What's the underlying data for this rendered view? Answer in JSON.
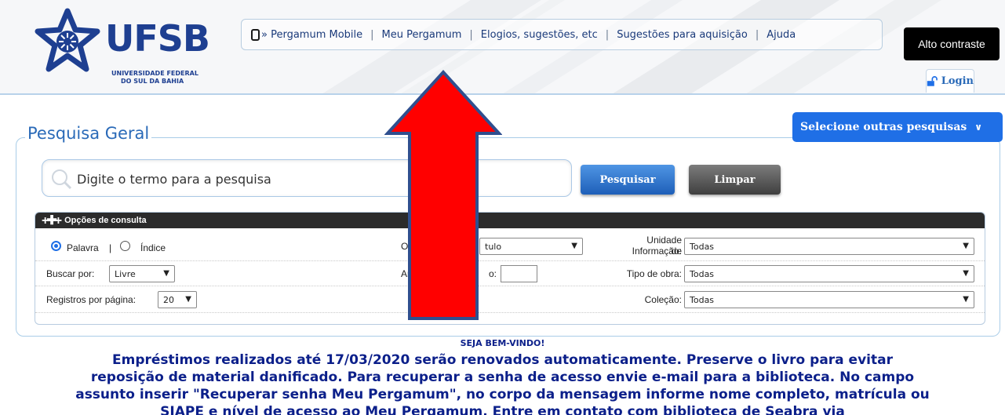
{
  "logo": {
    "name": "UFSB",
    "sub1": "UNIVERSIDADE FEDERAL",
    "sub2": "DO SUL DA BAHIA",
    "icon": "ufsb-star-logo"
  },
  "topnav": {
    "items": [
      {
        "label": "» Pergamum Mobile",
        "icon": "mobile-phone-icon"
      },
      {
        "label": "Meu Pergamum"
      },
      {
        "label": "Elogios, sugestões, etc"
      },
      {
        "label": "Sugestões para aquisição"
      },
      {
        "label": "Ajuda"
      }
    ],
    "separator": "|"
  },
  "contrast_button": "Alto contraste",
  "login_button": "Login",
  "search": {
    "title": "Pesquisa Geral",
    "other_searches": "Selecione outras pesquisas",
    "placeholder": "Digite o termo para a pesquisa",
    "search_button": "Pesquisar",
    "clear_button": "Limpar"
  },
  "options": {
    "header": "Opções de consulta",
    "palavra": "Palavra",
    "pipe": "|",
    "indice": "Índice",
    "ord_label": "Ord",
    "ord_value": "tulo",
    "unidade_label_1": "Unidade de",
    "unidade_label_2": "Informação:",
    "unidade_value": "Todas",
    "buscar_label": "Buscar por:",
    "buscar_value": "Livre",
    "ano_label": "Ano",
    "ano_suffix": "o:",
    "tipo_label": "Tipo de obra:",
    "tipo_value": "Todas",
    "registros_label": "Registros por página:",
    "registros_value": "20",
    "colecao_label": "Coleção:",
    "colecao_value": "Todas"
  },
  "welcome": "SEJA BEM-VINDO!",
  "notice_lines": [
    "Empréstimos realizados até 17/03/2020 serão renovados automaticamente. Preserve o livro para evitar",
    "reposição de material danificado. Para recuperar a senha de acesso envie e-mail para a biblioteca. No campo",
    "assunto inserir \"Recuperar senha Meu Pergamum\", no corpo da mensagem informe nome completo, matrícula ou",
    "SIAPE e nível de acesso ao Meu Pergamum. Entre em contato com biblioteca de Seabra via"
  ],
  "colors": {
    "brand_blue": "#1e3f91",
    "accent_blue": "#1f6fe6",
    "arrow_red": "#ff0000",
    "arrow_outline": "#2f4f8f"
  },
  "annotation": {
    "type": "up-arrow",
    "icon": "red-up-arrow"
  }
}
